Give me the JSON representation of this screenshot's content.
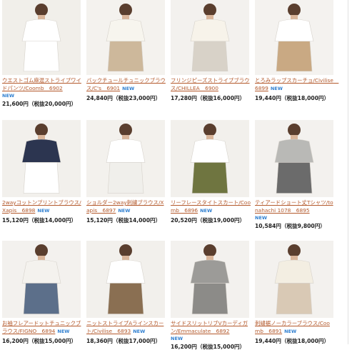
{
  "products": [
    {
      "title": "ウエストゴム麻混ストライプワイドパンツ/Coomb　6902",
      "new": true,
      "new_below": true,
      "price": "21,600円（税抜20,000円）",
      "colors": {
        "bg": "#f1efea",
        "top": "#ffffff",
        "bottom": "#ffffff"
      }
    },
    {
      "title": "バックチュールチュニックブラウス/C's　6901",
      "new": true,
      "new_below": false,
      "price": "24,840円（税抜23,000円）",
      "colors": {
        "bg": "#f4f2ee",
        "top": "#f7f5ee",
        "bottom": "#cdb89b"
      }
    },
    {
      "title": "フリンジピーズストライプブラウス/CHILLEA　6900",
      "new": false,
      "new_below": false,
      "price": "17,280円（税抜16,000円）",
      "colors": {
        "bg": "#f3f1ee",
        "top": "#f7f3ea",
        "bottom": "#d8d2c8"
      }
    },
    {
      "title": "とろみラップスカーチョ/Civilise　6899",
      "new": true,
      "new_below": false,
      "price": "19,440円（税抜18,000円）",
      "colors": {
        "bg": "#f4f2ef",
        "top": "#ffffff",
        "bottom": "#c9a983"
      }
    },
    {
      "title": "2wayコットンプリントブラウス/Xapis　6898",
      "new": true,
      "new_below": false,
      "price": "15,120円（税抜14,000円）",
      "colors": {
        "bg": "#f2f0ec",
        "top": "#2c3550",
        "bottom": "#ffffff"
      }
    },
    {
      "title": "ショルダー2way刺繍ブラウス/Xapis　6897",
      "new": true,
      "new_below": false,
      "price": "15,120円（税抜14,000円）",
      "colors": {
        "bg": "#f3f1ed",
        "top": "#ffffff",
        "bottom": "#f0efeb"
      }
    },
    {
      "title": "リーフレースタイトスカート/Coomb　6896",
      "new": true,
      "new_below": false,
      "price": "20,520円（税抜19,000円）",
      "colors": {
        "bg": "#f2f0ec",
        "top": "#ffffff",
        "bottom": "#6f7540"
      }
    },
    {
      "title": "ティアードショート丈Tシャツ/tonahachi 1078　6895",
      "new": true,
      "new_below": true,
      "price": "10,584円（税抜9,800円）",
      "colors": {
        "bg": "#f3f1ee",
        "top": "#b9b9b6",
        "bottom": "#6b6b6b"
      }
    },
    {
      "title": "お袖フレアードットチュニックブラウス/FIGNO　6894",
      "new": true,
      "new_below": false,
      "price": "16,200円（税抜15,000円）",
      "colors": {
        "bg": "#f3f1ee",
        "top": "#f4f2ee",
        "bottom": "#5c6f8a"
      }
    },
    {
      "title": "ニットストライプAラインスカート/Civilise　6893",
      "new": true,
      "new_below": false,
      "price": "18,360円（税抜17,000円）",
      "colors": {
        "bg": "#f2f0ec",
        "top": "#ffffff",
        "bottom": "#8a6f52"
      }
    },
    {
      "title": "サイドスリットリブVカーディガン/Emmaculate　6892",
      "new": true,
      "new_below": true,
      "price": "16,200円（税抜15,000円）",
      "colors": {
        "bg": "#f3f1ee",
        "top": "#9c9b98",
        "bottom": "#8c8b88"
      }
    },
    {
      "title": "刺繍裾ノーカラーブラウス/Coomb　6891",
      "new": true,
      "new_below": false,
      "price": "19,440円（税抜18,000円）",
      "colors": {
        "bg": "#f3f1ee",
        "top": "#f3eee2",
        "bottom": "#d9c9b5"
      }
    }
  ],
  "new_label": "NEW"
}
